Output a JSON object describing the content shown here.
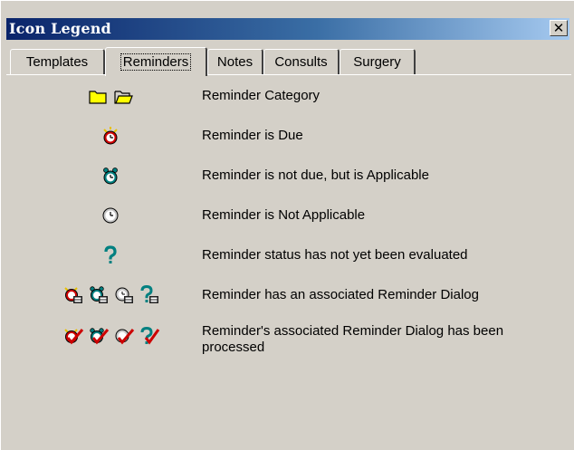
{
  "window": {
    "title": "Icon Legend",
    "close_glyph": "✕"
  },
  "tabs": [
    {
      "label": "Templates"
    },
    {
      "label": "Reminders",
      "active": true
    },
    {
      "label": "Notes"
    },
    {
      "label": "Consults"
    },
    {
      "label": "Surgery"
    }
  ],
  "legend": [
    {
      "label": "Reminder Category",
      "icons": [
        "folder-closed-icon",
        "folder-open-icon"
      ]
    },
    {
      "label": "Reminder is Due",
      "icons": [
        "ringing-red-alarm-clock-icon"
      ]
    },
    {
      "label": "Reminder is not due, but is Applicable",
      "icons": [
        "teal-alarm-clock-icon"
      ]
    },
    {
      "label": "Reminder is Not Applicable",
      "icons": [
        "clock-icon"
      ]
    },
    {
      "label": "Reminder status has not yet been evaluated",
      "icons": [
        "question-mark-icon"
      ]
    },
    {
      "label": "Reminder has an associated Reminder Dialog",
      "icons": [
        "due-dialog-icon",
        "applicable-dialog-icon",
        "not-applicable-dialog-icon",
        "unevaluated-dialog-icon"
      ]
    },
    {
      "label": "Reminder's associated Reminder Dialog has been processed",
      "icons": [
        "due-processed-icon",
        "applicable-processed-icon",
        "not-applicable-processed-icon",
        "unevaluated-processed-icon"
      ]
    }
  ],
  "colors": {
    "title_bar_start": "#0a246a",
    "title_bar_end": "#a6caf0",
    "window_bg": "#d4d0c8",
    "alert_red": "#cc0000",
    "teal": "#008080"
  }
}
